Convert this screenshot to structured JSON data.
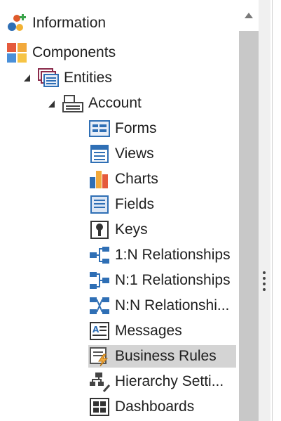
{
  "tree": {
    "information": {
      "label": "Information",
      "icon": "information-icon"
    },
    "components": {
      "label": "Components",
      "icon": "components-icon"
    },
    "entities": {
      "label": "Entities",
      "icon": "entities-icon",
      "expanded": true
    },
    "account": {
      "label": "Account",
      "icon": "entity-icon",
      "expanded": true
    },
    "items": [
      {
        "label": "Forms",
        "icon": "forms-icon"
      },
      {
        "label": "Views",
        "icon": "views-icon"
      },
      {
        "label": "Charts",
        "icon": "charts-icon"
      },
      {
        "label": "Fields",
        "icon": "fields-icon"
      },
      {
        "label": "Keys",
        "icon": "keys-icon"
      },
      {
        "label": "1:N Relationships",
        "icon": "one-to-many-icon"
      },
      {
        "label": "N:1 Relationships",
        "icon": "many-to-one-icon"
      },
      {
        "label": "N:N Relationshi...",
        "icon": "many-to-many-icon"
      },
      {
        "label": "Messages",
        "icon": "messages-icon"
      },
      {
        "label": "Business Rules",
        "icon": "business-rules-icon",
        "selected": true
      },
      {
        "label": "Hierarchy Setti...",
        "icon": "hierarchy-settings-icon"
      },
      {
        "label": "Dashboards",
        "icon": "dashboards-icon"
      }
    ]
  },
  "colors": {
    "selection": "#d4d4d4",
    "scrollbar_thumb": "#c8c8c8",
    "splitter": "#f0f0f0",
    "icon_blue": "#2f6fb5"
  }
}
